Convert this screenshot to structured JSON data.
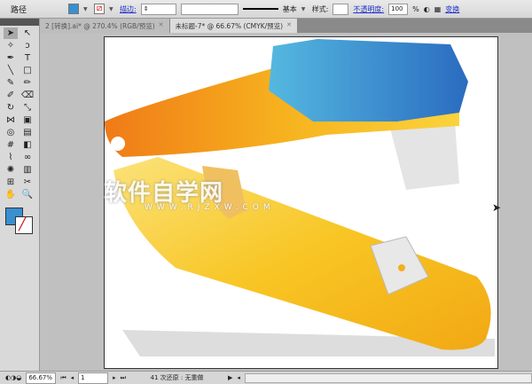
{
  "control": {
    "object_type": "路径",
    "stroke_label": "描边:",
    "stroke_style": "基本",
    "style_label": "样式:",
    "opacity_label": "不透明度:",
    "opacity_value": "100",
    "opacity_unit": "%",
    "transform_label": "变换",
    "fill_color": "#3a8fd0"
  },
  "tabs": [
    {
      "label": "2 [转换].ai* @ 270.4% (RGB/预览)",
      "active": false
    },
    {
      "label": "未标题-7* @ 66.67% (CMYK/预览)",
      "active": true
    }
  ],
  "watermark": {
    "title": "软件自学网",
    "url": "WWW.RJZXW.COM"
  },
  "status": {
    "zoom": "66.67%",
    "page": "1",
    "message": "41 次还原 : 无重做"
  }
}
